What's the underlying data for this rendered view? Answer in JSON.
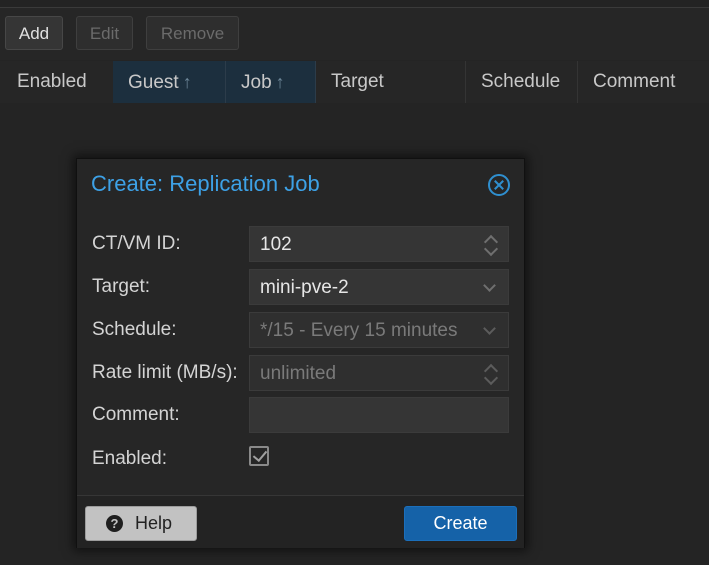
{
  "toolbar": {
    "add_label": "Add",
    "edit_label": "Edit",
    "remove_label": "Remove"
  },
  "grid": {
    "columns": {
      "enabled": "Enabled",
      "guest": "Guest",
      "job": "Job",
      "target": "Target",
      "schedule": "Schedule",
      "comment": "Comment"
    },
    "sort_glyph": "↑"
  },
  "dialog": {
    "title": "Create: Replication Job",
    "fields": {
      "ctvm_label": "CT/VM ID:",
      "ctvm_value": "102",
      "target_label": "Target:",
      "target_value": "mini-pve-2",
      "schedule_label": "Schedule:",
      "schedule_value": "*/15 - Every 15 minutes",
      "rate_label": "Rate limit (MB/s):",
      "rate_placeholder": "unlimited",
      "comment_label": "Comment:",
      "comment_value": "",
      "enabled_label": "Enabled:",
      "enabled_checked": true
    },
    "help_label": "Help",
    "help_glyph": "?",
    "create_label": "Create"
  },
  "colors": {
    "accent": "#3da1e6",
    "primary_button": "#1562a8",
    "background": "#242424"
  }
}
